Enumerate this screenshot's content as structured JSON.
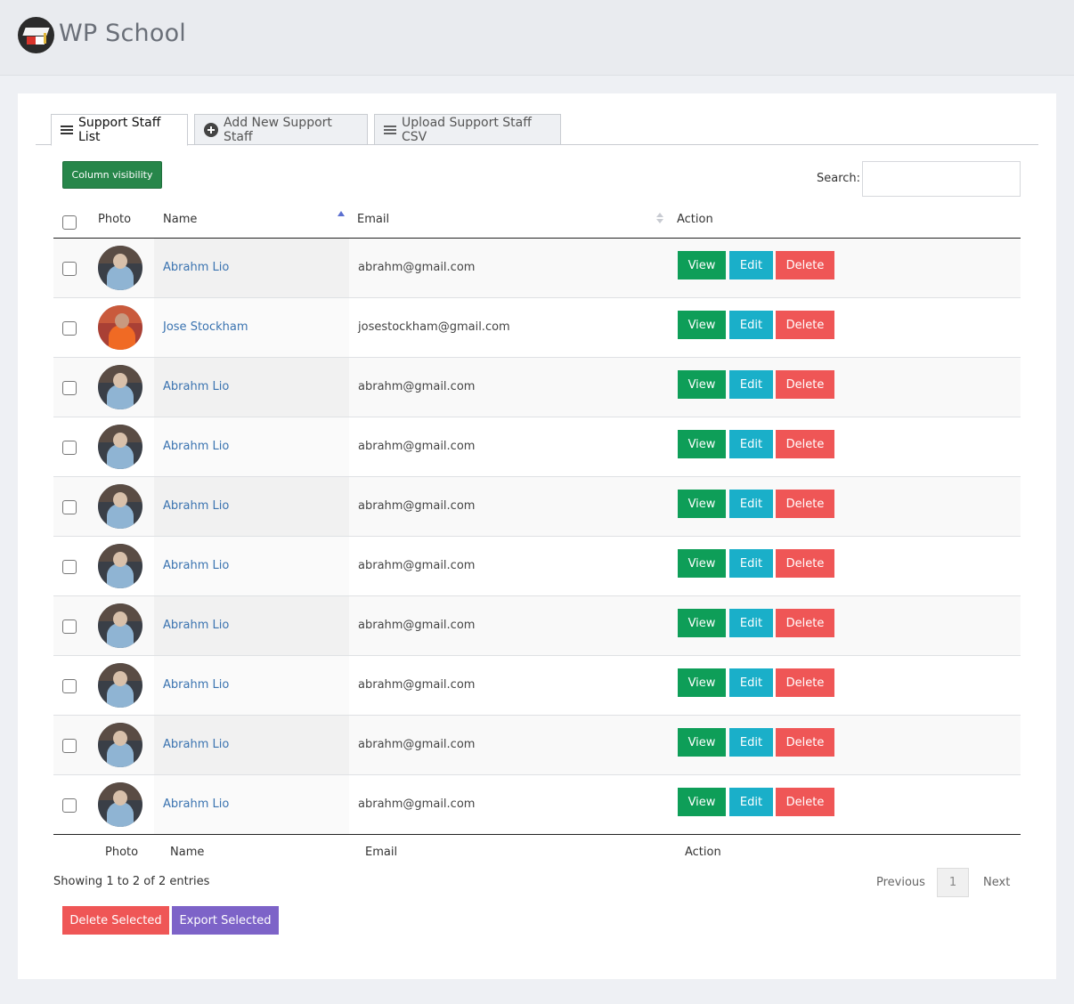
{
  "app": {
    "title": "WP School"
  },
  "tabs": [
    {
      "label": "Support Staff List",
      "icon": "list-icon",
      "active": true
    },
    {
      "label": "Add New Support Staff",
      "icon": "plus-circle-icon",
      "active": false
    },
    {
      "label": "Upload Support Staff CSV",
      "icon": "list-icon",
      "active": false
    }
  ],
  "toolbar": {
    "column_visibility": "Column visibility",
    "search_label": "Search:",
    "search_value": ""
  },
  "table": {
    "headers": {
      "photo": "Photo",
      "name": "Name",
      "email": "Email",
      "action": "Action"
    },
    "rows": [
      {
        "name": "Abrahm Lio",
        "email": "abrahm@gmail.com"
      },
      {
        "name": "Jose Stockham",
        "email": "josestockham@gmail.com"
      },
      {
        "name": "Abrahm Lio",
        "email": "abrahm@gmail.com"
      },
      {
        "name": "Abrahm Lio",
        "email": "abrahm@gmail.com"
      },
      {
        "name": "Abrahm Lio",
        "email": "abrahm@gmail.com"
      },
      {
        "name": "Abrahm Lio",
        "email": "abrahm@gmail.com"
      },
      {
        "name": "Abrahm Lio",
        "email": "abrahm@gmail.com"
      },
      {
        "name": "Abrahm Lio",
        "email": "abrahm@gmail.com"
      },
      {
        "name": "Abrahm Lio",
        "email": "abrahm@gmail.com"
      },
      {
        "name": "Abrahm Lio",
        "email": "abrahm@gmail.com"
      }
    ],
    "row_actions": {
      "view": "View",
      "edit": "Edit",
      "delete": "Delete"
    }
  },
  "pagination": {
    "info": "Showing 1 to 2 of 2 entries",
    "previous": "Previous",
    "current": "1",
    "next": "Next"
  },
  "bulk": {
    "delete_selected": "Delete Selected",
    "export_selected": "Export Selected"
  },
  "colors": {
    "view": "#0e9e58",
    "edit": "#1aafc9",
    "delete": "#ef5656",
    "export": "#7d63c8",
    "column_visibility": "#27864a",
    "link": "#3a73b0"
  }
}
